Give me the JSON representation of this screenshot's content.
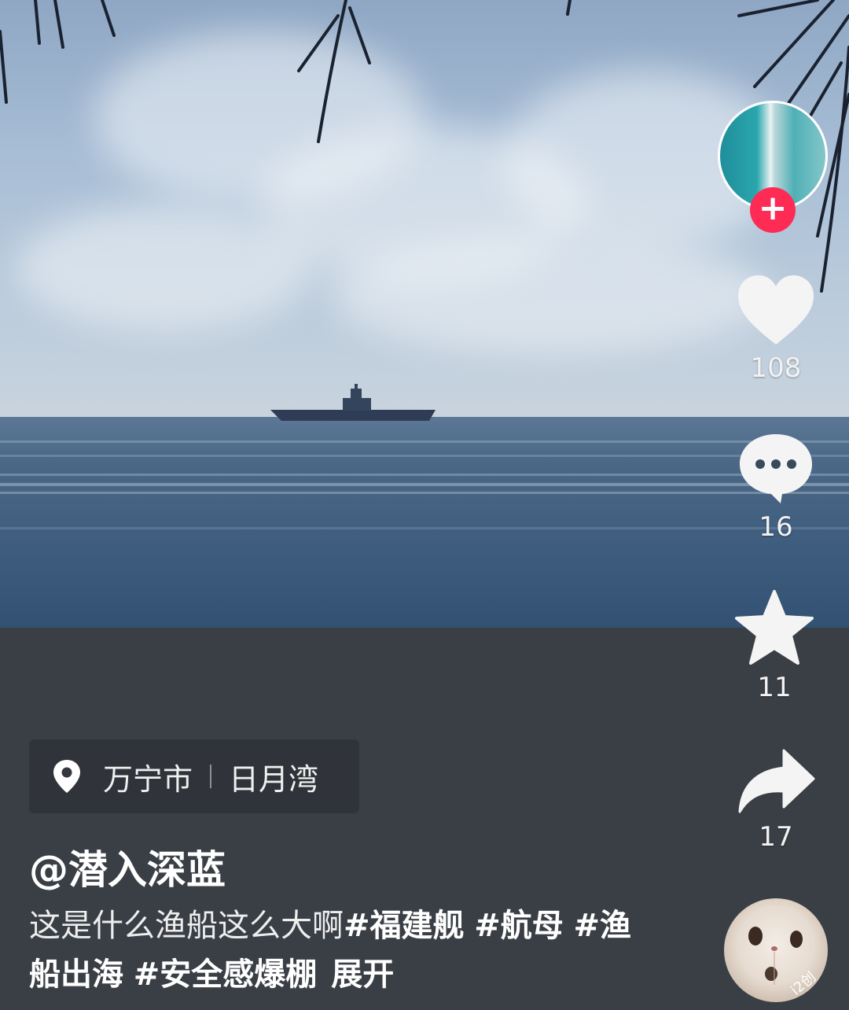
{
  "actions": {
    "like_count": "108",
    "comment_count": "16",
    "favorite_count": "11",
    "share_count": "17"
  },
  "location": {
    "city": "万宁市",
    "spot": "日月湾"
  },
  "post": {
    "author": "@潜入深蓝",
    "caption": "这是什么渔船这么大啊",
    "hashtags": [
      "#福建舰",
      "#航母",
      "#渔船出海",
      "#安全感爆棚"
    ],
    "expand_label": "展开"
  },
  "music_disc": {
    "label": "i2创"
  },
  "colors": {
    "follow_button": "#fe2c55",
    "panel_background": "#3a3f46"
  }
}
